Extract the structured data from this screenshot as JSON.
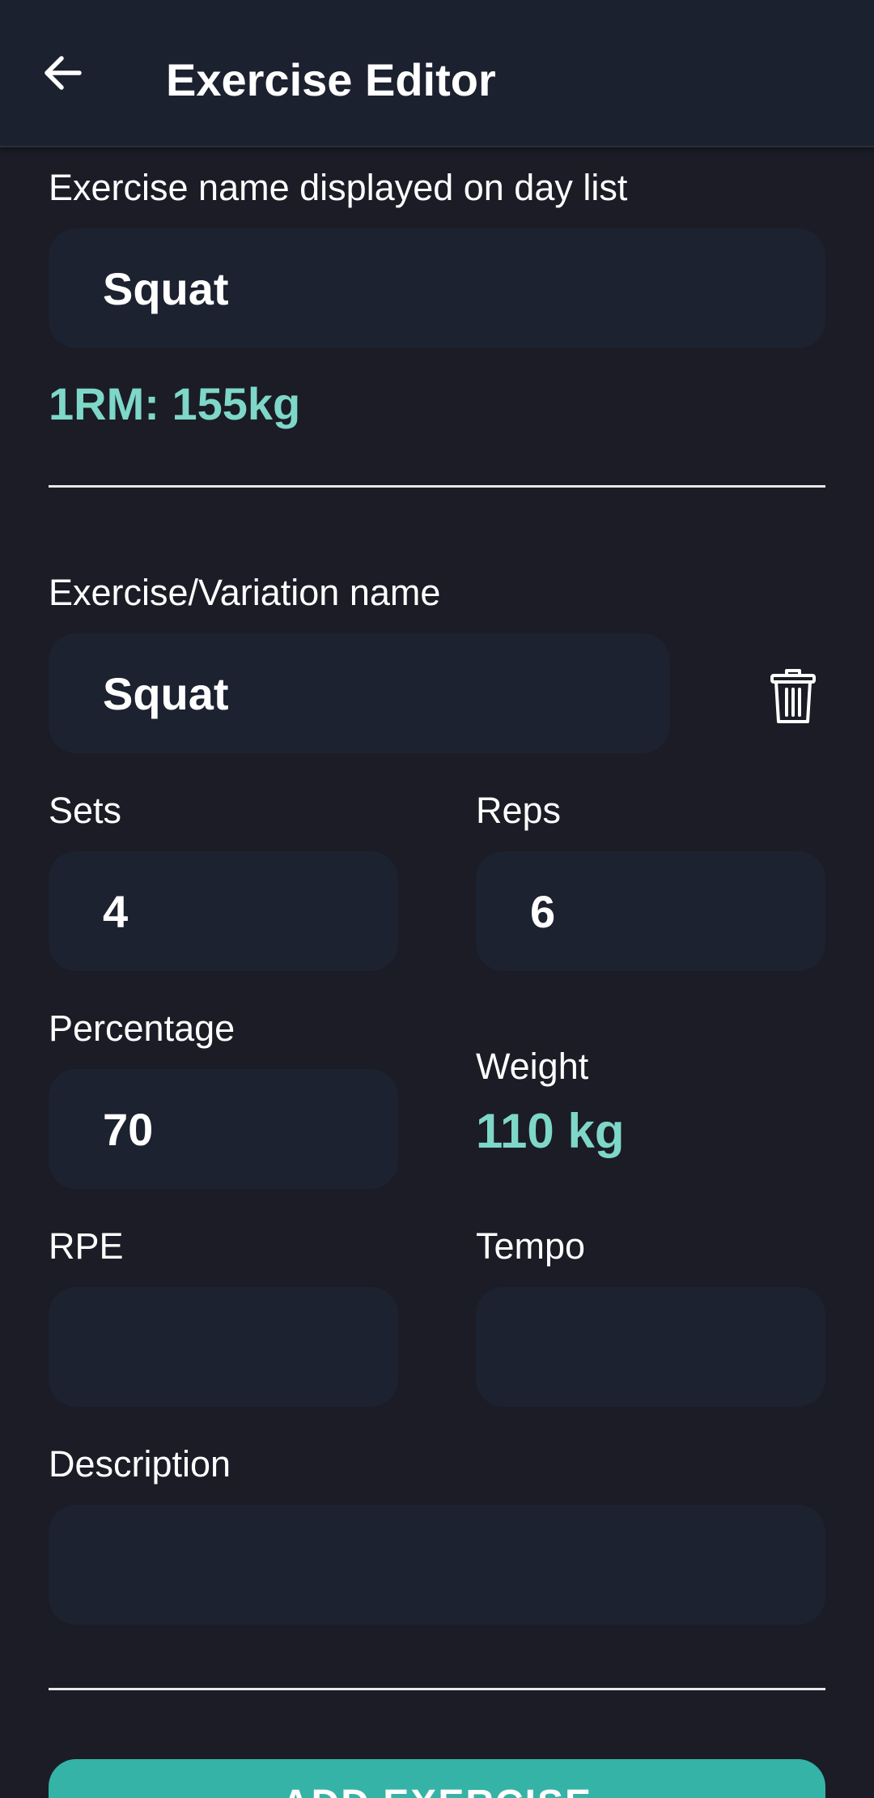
{
  "header": {
    "back_icon": "arrow-left-icon",
    "title": "Exercise Editor"
  },
  "display_name": {
    "label": "Exercise name displayed on day list",
    "value": "Squat"
  },
  "one_rm": "1RM: 155kg",
  "variation": {
    "label": "Exercise/Variation name",
    "value": "Squat",
    "delete_icon": "trash-icon"
  },
  "sets": {
    "label": "Sets",
    "value": "4"
  },
  "reps": {
    "label": "Reps",
    "value": "6"
  },
  "percentage": {
    "label": "Percentage",
    "value": "70"
  },
  "weight": {
    "label": "Weight",
    "value": "110 kg"
  },
  "rpe": {
    "label": "RPE",
    "value": ""
  },
  "tempo": {
    "label": "Tempo",
    "value": ""
  },
  "description": {
    "label": "Description",
    "value": ""
  },
  "add_button": "ADD EXERCISE",
  "colors": {
    "background": "#1b1c25",
    "field": "#1c2230",
    "accent": "#7ed7c9",
    "button": "#35b3a6"
  }
}
